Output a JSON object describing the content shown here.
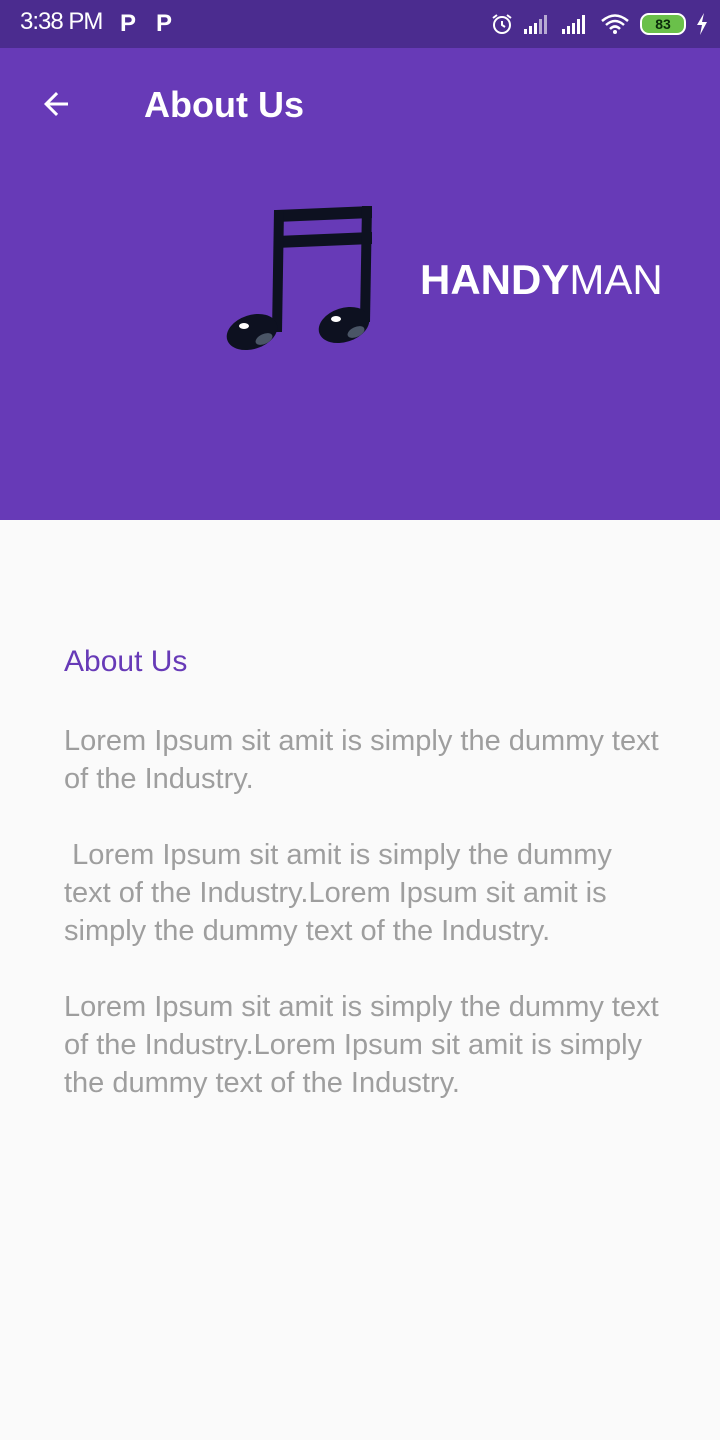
{
  "status_bar": {
    "time": "3:38 PM",
    "notif1": "P",
    "notif2": "P",
    "battery": "83",
    "icons": [
      "alarm-icon",
      "signal-icon",
      "signal-icon",
      "wifi-icon",
      "battery-icon",
      "charging-icon"
    ]
  },
  "app_bar": {
    "title": "About Us",
    "back_icon": "arrow-back-icon",
    "brand_bold": "HANDY",
    "brand_light": "MAN",
    "logo_icon": "music-note-icon",
    "color": "#673ab7"
  },
  "content": {
    "heading": "About Us",
    "paragraphs": [
      "Lorem Ipsum sit amit is simply the dummy text of the Industry.",
      " Lorem Ipsum sit amit is simply the dummy text of the Industry.Lorem Ipsum sit amit is simply the dummy text of the Industry.",
      "Lorem Ipsum sit amit is simply the dummy text of the Industry.Lorem Ipsum sit amit is simply the dummy text of the Industry."
    ]
  }
}
